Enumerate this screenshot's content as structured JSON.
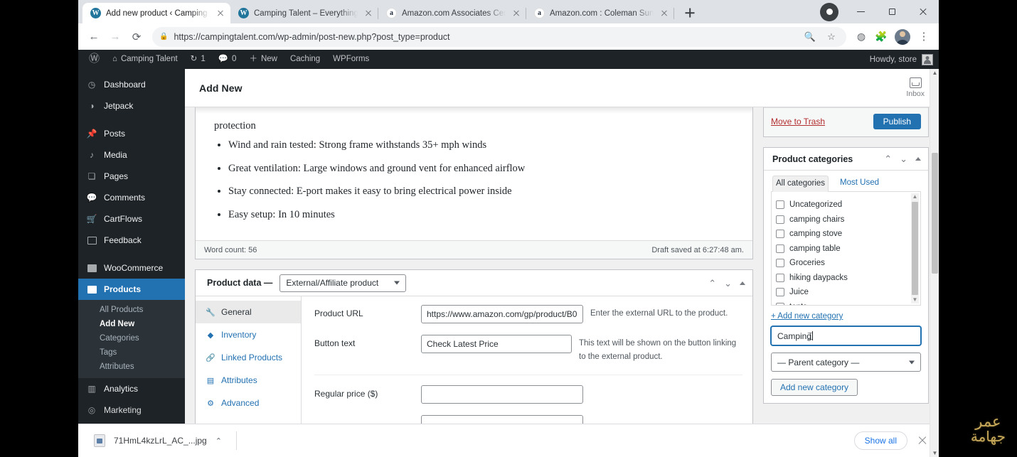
{
  "browser": {
    "tabs": [
      {
        "title": "Add new product ‹ Camping Tale",
        "favicon": "wordpress-icon",
        "active": true
      },
      {
        "title": "Camping Talent – Everything you",
        "favicon": "wordpress-icon",
        "active": false
      },
      {
        "title": "Amazon.com Associates Central",
        "favicon": "amazon-icon",
        "active": false
      },
      {
        "title": "Amazon.com : Coleman Sundom",
        "favicon": "amazon-icon",
        "active": false
      }
    ],
    "new_tab_label": "+",
    "window_controls": {
      "minimize": "–",
      "maximize": "▢",
      "close": "✕"
    },
    "nav": {
      "back": "←",
      "forward": "→",
      "reload": "⟳"
    },
    "omnibox": {
      "lock": "🔒",
      "url": "https://campingtalent.com/wp-admin/post-new.php?post_type=product",
      "search_icon": "search-icon",
      "bookmark_icon": "star-icon"
    },
    "toolbar_icons": [
      "extensions-puzzle-icon",
      "profile-avatar",
      "kebab-menu-icon"
    ]
  },
  "adminbar": {
    "logo": "wordpress-logo",
    "site_name": "Camping Talent",
    "updates_count": "1",
    "comments_count": "0",
    "new_label": "New",
    "caching_label": "Caching",
    "wpforms_label": "WPForms",
    "howdy": "Howdy, store"
  },
  "sidebar": {
    "items": [
      {
        "label": "Dashboard",
        "icon": "dashboard-icon"
      },
      {
        "label": "Jetpack",
        "icon": "jetpack-icon"
      },
      {
        "label": "Posts",
        "icon": "pin-icon"
      },
      {
        "label": "Media",
        "icon": "media-icon"
      },
      {
        "label": "Pages",
        "icon": "pages-icon"
      },
      {
        "label": "Comments",
        "icon": "comment-icon"
      },
      {
        "label": "CartFlows",
        "icon": "cart-icon"
      },
      {
        "label": "Feedback",
        "icon": "feedback-icon"
      },
      {
        "label": "WooCommerce",
        "icon": "woocommerce-icon"
      },
      {
        "label": "Products",
        "icon": "products-icon",
        "current": true
      },
      {
        "label": "Analytics",
        "icon": "analytics-icon"
      },
      {
        "label": "Marketing",
        "icon": "marketing-icon"
      }
    ],
    "submenu": [
      {
        "label": "All Products",
        "current": false
      },
      {
        "label": "Add New",
        "current": true
      },
      {
        "label": "Categories",
        "current": false
      },
      {
        "label": "Tags",
        "current": false
      },
      {
        "label": "Attributes",
        "current": false
      }
    ]
  },
  "page_header": {
    "title": "Add New",
    "inbox_label": "Inbox"
  },
  "editor": {
    "clipped_line": "………… protection…………",
    "paragraph": "protection",
    "bullets": [
      "Wind and rain tested: Strong frame withstands 35+ mph winds",
      "Great ventilation: Large windows and ground vent for enhanced airflow",
      "Stay connected: E-port makes it easy to bring electrical power inside",
      "Easy setup: In 10 minutes"
    ],
    "word_count": "Word count: 56",
    "draft_saved": "Draft saved at 6:27:48 am."
  },
  "product_data": {
    "title": "Product data —",
    "type_selected": "External/Affiliate product",
    "tabs": [
      {
        "label": "General",
        "icon": "wrench-icon",
        "active": true
      },
      {
        "label": "Inventory",
        "icon": "inventory-icon",
        "active": false
      },
      {
        "label": "Linked Products",
        "icon": "link-icon",
        "active": false
      },
      {
        "label": "Attributes",
        "icon": "attributes-icon",
        "active": false
      },
      {
        "label": "Advanced",
        "icon": "gear-icon",
        "active": false
      }
    ],
    "fields": [
      {
        "label": "Product URL",
        "value": "https://www.amazon.com/gp/product/B0",
        "help": "Enter the external URL to the product."
      },
      {
        "label": "Button text",
        "value": "Check Latest Price",
        "help": "This text will be shown on the button linking to the external product."
      },
      {
        "label": "Regular price ($)",
        "value": "",
        "help": ""
      }
    ]
  },
  "publish_box": {
    "move_to_trash": "Move to Trash",
    "publish": "Publish"
  },
  "product_categories": {
    "title": "Product categories",
    "tabs": [
      {
        "label": "All categories",
        "active": true
      },
      {
        "label": "Most Used",
        "active": false
      }
    ],
    "categories": [
      "Uncategorized",
      "camping chairs",
      "camping stove",
      "camping table",
      "Groceries",
      "hiking daypacks",
      "Juice",
      "tents"
    ],
    "add_new_link": "+ Add new category",
    "new_category_value": "Camping",
    "parent_category_placeholder": "— Parent category —",
    "add_button": "Add new category"
  },
  "download_shelf": {
    "file_name": "71HmL4kzLrL_AC_...jpg",
    "show_all": "Show all",
    "close": "✕"
  },
  "watermark": {
    "line1": "عمر",
    "line2": "جهامة"
  },
  "colors": {
    "wp_blue": "#2271b1",
    "wp_dark": "#1d2327",
    "chrome_tabstrip": "#dee1e6",
    "link_blue": "#1a73e8",
    "trash_red": "#b32d2e",
    "watermark_gold": "#c8a95a"
  }
}
